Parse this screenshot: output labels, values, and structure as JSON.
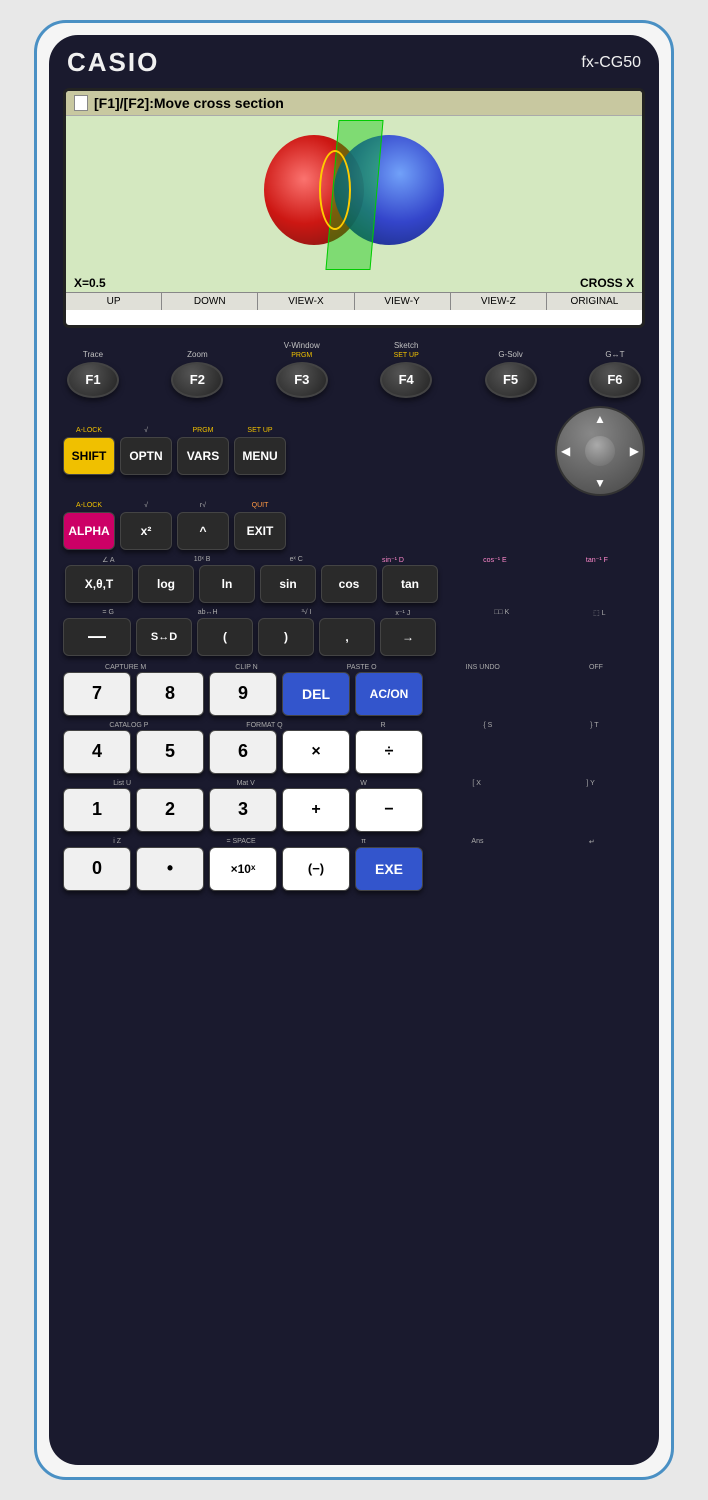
{
  "header": {
    "brand": "CASIO",
    "model": "fx-CG50"
  },
  "screen": {
    "title": "[F1]/[F2]:Move cross section",
    "x_value": "X=0.5",
    "cross_label": "CROSS X",
    "fn_buttons": [
      "UP",
      "DOWN",
      "VIEW-X",
      "VIEW-Y",
      "VIEW-Z",
      "ORIGINAL"
    ]
  },
  "fkeys": [
    {
      "label": "F1",
      "top": "Trace"
    },
    {
      "label": "F2",
      "top": "Zoom"
    },
    {
      "label": "F3",
      "top": "V-Window",
      "sub": "PRGM"
    },
    {
      "label": "F4",
      "top": "Sketch",
      "sub": "SET UP"
    },
    {
      "label": "F5",
      "top": "G-Solv"
    },
    {
      "label": "F6",
      "top": "G↔T"
    }
  ],
  "row1": {
    "shift": "SHIFT",
    "optn": "OPTN",
    "vars": "VARS",
    "menu": "MENU",
    "sub_vars": "PRGM",
    "sub_menu": "SET UP"
  },
  "row2": {
    "alpha": "ALPHA",
    "x2": "x²",
    "up_arrow": "^",
    "exit": "EXIT",
    "sub_alpha": "A-LOCK",
    "sub_x2": "√",
    "sub_up": "r √",
    "sub_exit": "QUIT"
  },
  "row3": {
    "xtheta": "X,θ,T",
    "log": "log",
    "ln": "ln",
    "sin": "sin",
    "cos": "cos",
    "tan": "tan",
    "sub_xtheta": "∠  A",
    "sub_log": "10ˣ  B",
    "sub_ln": "eˣ  C",
    "sub_sin": "sin⁻¹  D",
    "sub_cos": "cos⁻¹  E",
    "sub_tan": "tan⁻¹  F"
  },
  "row4": {
    "frac": "—",
    "sd": "S↔D",
    "lparen": "(",
    "rparen": ")",
    "comma": ",",
    "arrow": "→",
    "sub_frac": "= G",
    "sub_sd": "ab÷↔H",
    "sub_lparen": "³√  I",
    "sub_rparen": "x⁻¹  J",
    "sub_comma": "□□  K",
    "sub_arrow": "⬚  L"
  },
  "numkeys": [
    {
      "num": "7",
      "sub_top": "CAPTURE M",
      "sub_bot": ""
    },
    {
      "num": "8",
      "sub_top": "CLIP  N",
      "sub_bot": ""
    },
    {
      "num": "9",
      "sub_top": "PASTE  O",
      "sub_bot": ""
    },
    {
      "num": "DEL",
      "sub_top": "INS",
      "sub_bot": "",
      "type": "blue"
    },
    {
      "num": "AC/ON",
      "sub_top": "OFF",
      "sub_bot": "",
      "type": "blue"
    },
    {
      "num": "4",
      "sub_top": "CATALOG P",
      "sub_bot": ""
    },
    {
      "num": "5",
      "sub_top": "FORMAT  Q",
      "sub_bot": ""
    },
    {
      "num": "6",
      "sub_top": "R",
      "sub_bot": ""
    },
    {
      "num": "×",
      "sub_top": "{  S",
      "sub_bot": ""
    },
    {
      "num": "÷",
      "sub_top": "}  T",
      "sub_bot": ""
    },
    {
      "num": "1",
      "sub_top": "List  U",
      "sub_bot": ""
    },
    {
      "num": "2",
      "sub_top": "Mat  V",
      "sub_bot": ""
    },
    {
      "num": "3",
      "sub_top": "W",
      "sub_bot": ""
    },
    {
      "num": "+",
      "sub_top": "[  X",
      "sub_bot": ""
    },
    {
      "num": "−",
      "sub_top": "]  Y",
      "sub_bot": ""
    },
    {
      "num": "0",
      "sub_top": "i  Z",
      "sub_bot": ""
    },
    {
      "num": "•",
      "sub_top": "=",
      "sub_bot": "SPACE"
    },
    {
      "num": "×10ˣ",
      "sub_top": "π",
      "sub_bot": ""
    },
    {
      "num": "(−)",
      "sub_top": "Ans",
      "sub_bot": ""
    },
    {
      "num": "EXE",
      "sub_top": "↵",
      "sub_bot": "",
      "type": "exe"
    }
  ],
  "colors": {
    "body_bg": "#1a1a2e",
    "screen_bg": "#d4e8c0",
    "brand_color": "#f0f0f0",
    "border_color": "#4a90c4",
    "shift_color": "#f0c000",
    "alpha_color": "#cc0066",
    "blue_key_color": "#3355cc"
  }
}
